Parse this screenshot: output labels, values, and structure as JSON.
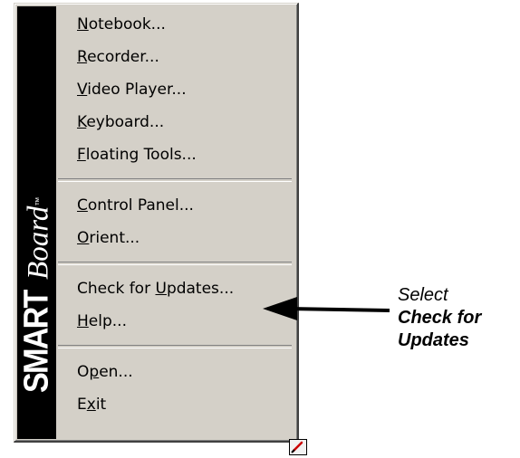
{
  "brand": {
    "smart": "SMART",
    "board": "Board",
    "trademark": "™"
  },
  "menu": {
    "groups": [
      [
        {
          "pre": "",
          "mnemonic": "N",
          "post": "otebook..."
        },
        {
          "pre": "",
          "mnemonic": "R",
          "post": "ecorder..."
        },
        {
          "pre": "",
          "mnemonic": "V",
          "post": "ideo Player..."
        },
        {
          "pre": "",
          "mnemonic": "K",
          "post": "eyboard..."
        },
        {
          "pre": "",
          "mnemonic": "F",
          "post": "loating Tools..."
        }
      ],
      [
        {
          "pre": "",
          "mnemonic": "C",
          "post": "ontrol Panel..."
        },
        {
          "pre": "",
          "mnemonic": "O",
          "post": "rient..."
        }
      ],
      [
        {
          "pre": "Check for ",
          "mnemonic": "U",
          "post": "pdates..."
        },
        {
          "pre": "",
          "mnemonic": "H",
          "post": "elp..."
        }
      ],
      [
        {
          "pre": "O",
          "mnemonic": "p",
          "post": "en..."
        },
        {
          "pre": "E",
          "mnemonic": "x",
          "post": "it"
        }
      ]
    ]
  },
  "callout": {
    "line1": "Select",
    "line2": "Check for",
    "line3": "Updates"
  },
  "tray_icon": "smart-board-tray-icon",
  "colors": {
    "menu_bg": "#d4d0c8",
    "brand_strip": "#000000",
    "tray_pen": "#cc0000"
  }
}
